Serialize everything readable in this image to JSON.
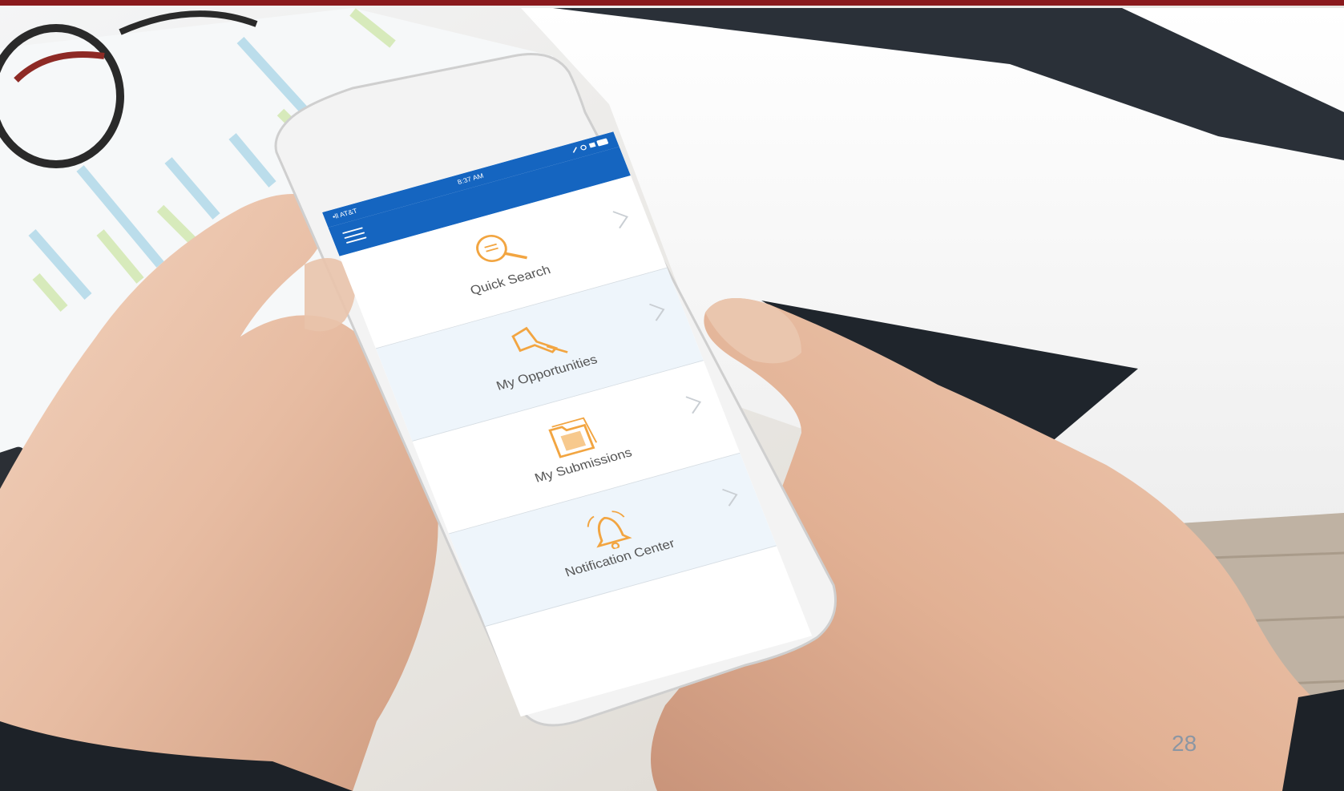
{
  "slide": {
    "page_number": "28",
    "top_bar_color": "#8a1a1d"
  },
  "phone": {
    "status": {
      "carrier": "•ll AT&T",
      "time": "8:37 AM"
    },
    "theme": {
      "nav_color": "#1565c0",
      "accent_color": "#f2a541",
      "row_alt_color": "#eef5fb"
    },
    "menu_icon": "hamburger-menu-icon",
    "items": [
      {
        "label": "Quick Search",
        "icon": "magnifier-icon"
      },
      {
        "label": "My Opportunities",
        "icon": "pushpin-icon"
      },
      {
        "label": "My Submissions",
        "icon": "folder-icon"
      },
      {
        "label": "Notification Center",
        "icon": "bell-icon"
      }
    ]
  }
}
